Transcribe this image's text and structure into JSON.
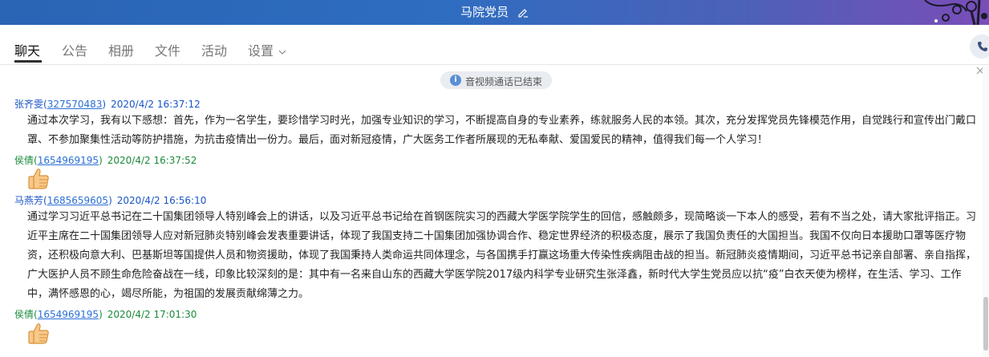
{
  "window": {
    "title": "马院党员"
  },
  "tabs": [
    {
      "label": "聊天"
    },
    {
      "label": "公告"
    },
    {
      "label": "相册"
    },
    {
      "label": "文件"
    },
    {
      "label": "活动"
    },
    {
      "label": "设置"
    }
  ],
  "notice": {
    "text": "音视频通话已结束"
  },
  "messages": [
    {
      "name": "张齐雯",
      "qq": "327570483",
      "time": "2020/4/2 16:37:12",
      "lines": [
        "通过本次学习，我有以下感想：首先，作为一名学生，要珍惜学习时光，加强专业知识的学习，不断提高自身的专业素养，练就服务人民的本领。其次，充分发挥党员先锋模范作用，自觉践行和宣传出门戴口",
        "罩、不参加聚集性活动等防护措施，为抗击疫情出一份力。最后，面对新冠疫情，广大医务工作者所展现的无私奉献、爱国爱民的精神，值得我们每一个人学习！"
      ]
    },
    {
      "name": "侯倩",
      "qq": "1654969195",
      "time": "2020/4/2 16:37:52",
      "icon": "thumbs-up-icon"
    },
    {
      "name": "马燕芳",
      "qq": "1685659605",
      "time": "2020/4/2 16:56:10",
      "lines": [
        "通过学习习近平总书记在二十国集团领导人特别峰会上的讲话，以及习近平总书记给在首钢医院实习的西藏大学医学院学生的回信，感触颇多，现简略谈一下本人的感受，若有不当之处，请大家批评指正。习",
        "近平主席在二十国集团领导人应对新冠肺炎特别峰会发表重要讲话，体现了我国支持二十国集团加强协调合作、稳定世界经济的积极态度，展示了我国负责任的大国担当。我国不仅向日本援助口罩等医疗物",
        "资，还积极向意大利、巴基斯坦等国提供人员和物资援助，体现了我国秉持人类命运共同体理念，与各国携手打赢这场重大传染性疾病阻击战的担当。新冠肺炎疫情期间，习近平总书记亲自部署、亲自指挥，",
        "广大医护人员不顾生命危险奋战在一线，印象比较深刻的是：其中有一名来自山东的西藏大学医学院2017级内科学专业研究生张泽鑫，新时代大学生党员应以抗“疫”白衣天使为榜样，在生活、学习、工作",
        "中，满怀感恩的心，竭尽所能，为祖国的发展贡献绵薄之力。"
      ]
    },
    {
      "name": "侯倩",
      "qq": "1654969195",
      "time": "2020/4/2 17:01:30",
      "icon": "thumbs-up-icon"
    }
  ],
  "colors": {
    "titlebar": "#2e6dc0",
    "name_blue": "#1a55c8",
    "name_green": "#1b8a3a",
    "link": "#2a6fd6"
  }
}
